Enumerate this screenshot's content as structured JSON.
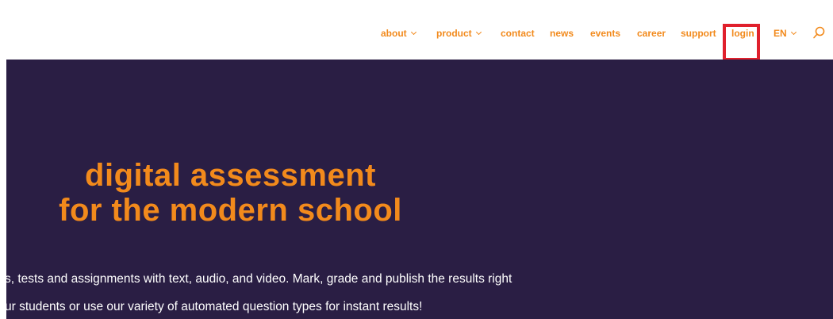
{
  "nav": {
    "items": [
      {
        "label": "about",
        "has_dropdown": true
      },
      {
        "label": "product",
        "has_dropdown": true
      },
      {
        "label": "contact",
        "has_dropdown": false
      },
      {
        "label": "news",
        "has_dropdown": false
      },
      {
        "label": "events",
        "has_dropdown": false
      },
      {
        "label": "career",
        "has_dropdown": false
      },
      {
        "label": "support",
        "has_dropdown": false
      },
      {
        "label": "login",
        "has_dropdown": false,
        "highlighted": true
      },
      {
        "label": "EN",
        "has_dropdown": true
      }
    ],
    "search_icon": "search-icon",
    "chevron_icon": "chevron-down-icon"
  },
  "hero": {
    "headline_line1": "digital assessment",
    "headline_line2": "for the modern school",
    "body_line1": "s, tests and assignments with text, audio, and video.  Mark, grade and publish the results right",
    "body_line2": "ur students or use our variety of automated question types for instant results!"
  },
  "colors": {
    "accent": "#f28a1c",
    "hero_background": "#2a1e44",
    "highlight_box": "#e0202c",
    "header_background": "#ffffff",
    "body_text": "#ffffff"
  }
}
